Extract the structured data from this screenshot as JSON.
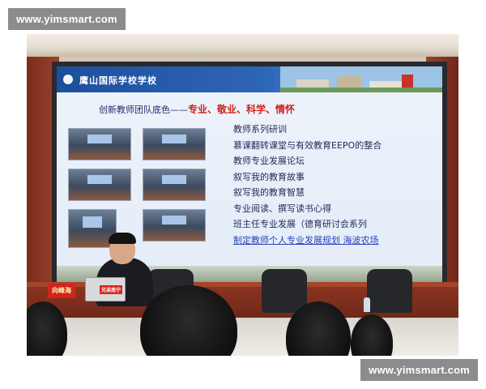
{
  "watermarks": {
    "top": "www.yimsmart.com",
    "bottom": "www.yimsmart.com"
  },
  "slide": {
    "banner_title": "鹰山国际学校学校",
    "title_prefix": "创新教师团队底色——",
    "title_highlight": "专业、敬业、科学、情怀",
    "items": [
      "教师系列研训",
      "慕课翻转课堂与有效教育EEPO的整合",
      "教师专业发展论坛",
      "叙写我的教育故事",
      "叙写我的教育智慧",
      "专业阅读、撰写读书心得",
      "班主任专业发展（德育研讨会系列",
      "制定教师个人专业发展规划  海波农场"
    ]
  },
  "room": {
    "nameplate": "向峰海",
    "laptop_sticker": "兄弟南宁"
  },
  "colors": {
    "accent_red": "#d0201a",
    "banner_blue": "#1d4f9c",
    "watermark_bg": "#8c8c8c"
  }
}
